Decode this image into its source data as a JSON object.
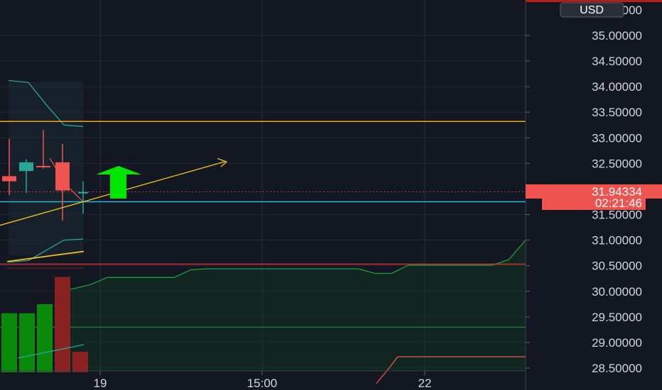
{
  "chart_data": {
    "type": "candlestick",
    "currency": "USD",
    "y_axis": {
      "ticks": [
        "28.50000",
        "29.00000",
        "29.50000",
        "30.00000",
        "30.50000",
        "31.00000",
        "31.50000",
        "32.50000",
        "33.00000",
        "33.50000",
        "34.00000",
        "34.50000",
        "35.00000"
      ],
      "range": [
        28.48,
        35.52
      ]
    },
    "x_axis": {
      "ticks": [
        "19",
        "15:00",
        "22"
      ]
    },
    "candles": [
      {
        "open": 32.25,
        "close": 32.15,
        "high": 32.98,
        "low": 31.88
      },
      {
        "open": 32.35,
        "close": 32.52,
        "high": 32.58,
        "low": 31.92
      },
      {
        "open": 32.45,
        "close": 32.43,
        "high": 33.15,
        "low": 32.4
      },
      {
        "open": 32.52,
        "close": 31.97,
        "high": 32.88,
        "low": 31.38
      },
      {
        "open": 31.94,
        "close": 31.94,
        "high": 32.15,
        "low": 31.52
      }
    ],
    "volume": {
      "values": [
        0.52,
        0.52,
        0.6,
        0.84,
        0.18
      ],
      "directions": [
        "up",
        "up",
        "up",
        "down",
        "down"
      ]
    },
    "price_tags": {
      "last_price": "31.94334",
      "countdown": "02:21:46"
    },
    "levels": {
      "resistance": 33.32,
      "support": 31.75,
      "red_level": 30.53,
      "last_price_value": 31.94334
    },
    "indicator_line_values": [
      30.0,
      30.05,
      30.13,
      30.27,
      30.27,
      30.27,
      30.27,
      30.27,
      30.42,
      30.44,
      30.44,
      30.44,
      30.44,
      30.44,
      30.44,
      30.44,
      30.44,
      30.44,
      30.44,
      30.35,
      30.35,
      30.51,
      30.51,
      30.51,
      30.51,
      30.51,
      30.51,
      30.62,
      31.0
    ],
    "indicator_mid_line": 29.3,
    "lower_red_line": [
      28.2,
      28.5,
      28.72,
      28.72
    ],
    "arrow_direction": "up",
    "colors": {
      "up": "#26a69a",
      "down": "#ef5350",
      "resistance": "#f7a21b",
      "support": "#29b6d8",
      "red_level": "#d32f2f",
      "signal_arrow": "#00e600",
      "volume_up": "#0a8a0a",
      "volume_down": "#8b2222",
      "indicator": "#1f9e3f",
      "trend": "#f7c11b"
    }
  }
}
